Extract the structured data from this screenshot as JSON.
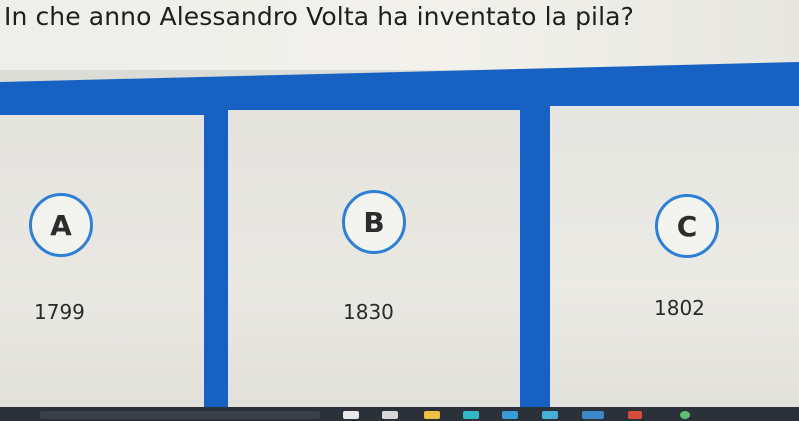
{
  "question": "In che anno Alessandro Volta ha inventato la pila?",
  "answers": [
    {
      "letter": "A",
      "year": "1799"
    },
    {
      "letter": "B",
      "year": "1830"
    },
    {
      "letter": "C",
      "year": "1802"
    }
  ],
  "colors": {
    "band": "#1761c3",
    "circle_border": "#2e7fd6",
    "card": "#e6e5e0",
    "taskbar": "#2b3138"
  }
}
